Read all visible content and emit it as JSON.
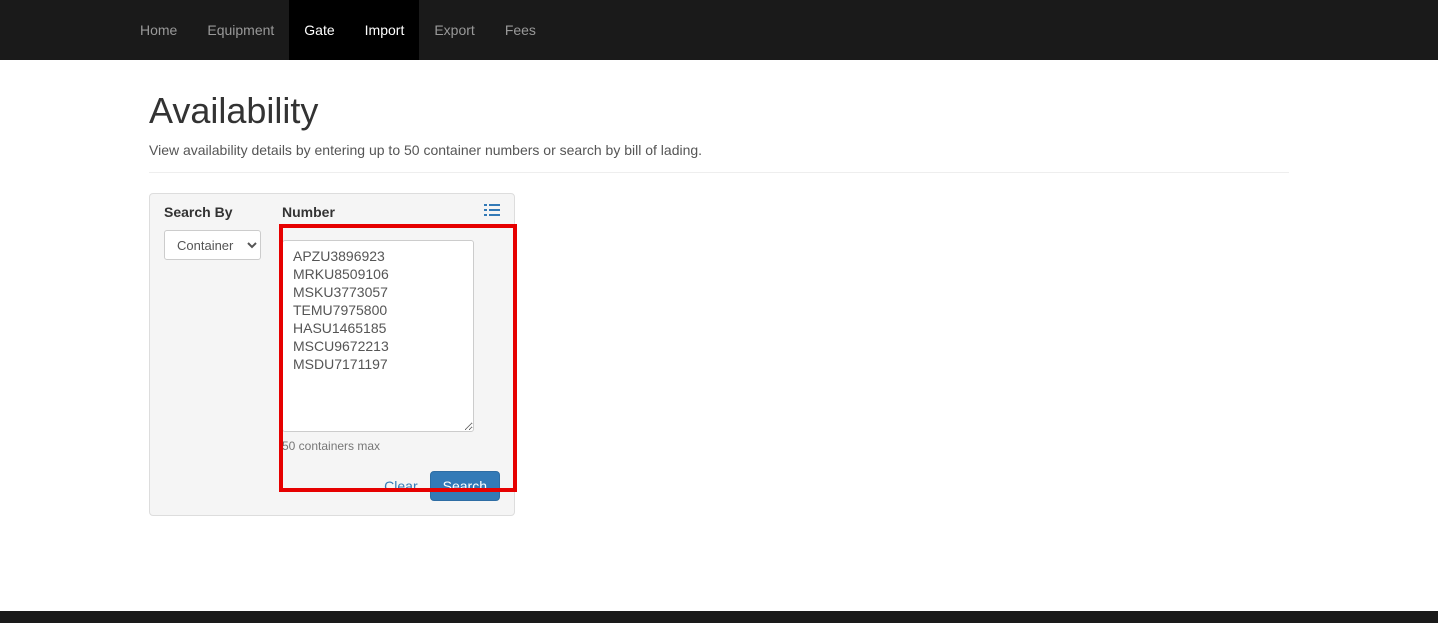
{
  "nav": {
    "items": [
      {
        "label": "Home",
        "active": false
      },
      {
        "label": "Equipment",
        "active": false
      },
      {
        "label": "Gate",
        "active": true
      },
      {
        "label": "Import",
        "active": true
      },
      {
        "label": "Export",
        "active": false
      },
      {
        "label": "Fees",
        "active": false
      }
    ]
  },
  "page": {
    "title": "Availability",
    "subtitle": "View availability details by entering up to 50 container numbers or search by bill of lading."
  },
  "search": {
    "search_by_label": "Search By",
    "search_by_value": "Container",
    "number_label": "Number",
    "textarea_value": "APZU3896923\nMRKU8509106\nMSKU3773057\nTEMU7975800\nHASU1465185\nMSCU9672213\nMSDU7171197",
    "helper": "50 containers max",
    "clear_label": "Clear",
    "search_label": "Search"
  }
}
